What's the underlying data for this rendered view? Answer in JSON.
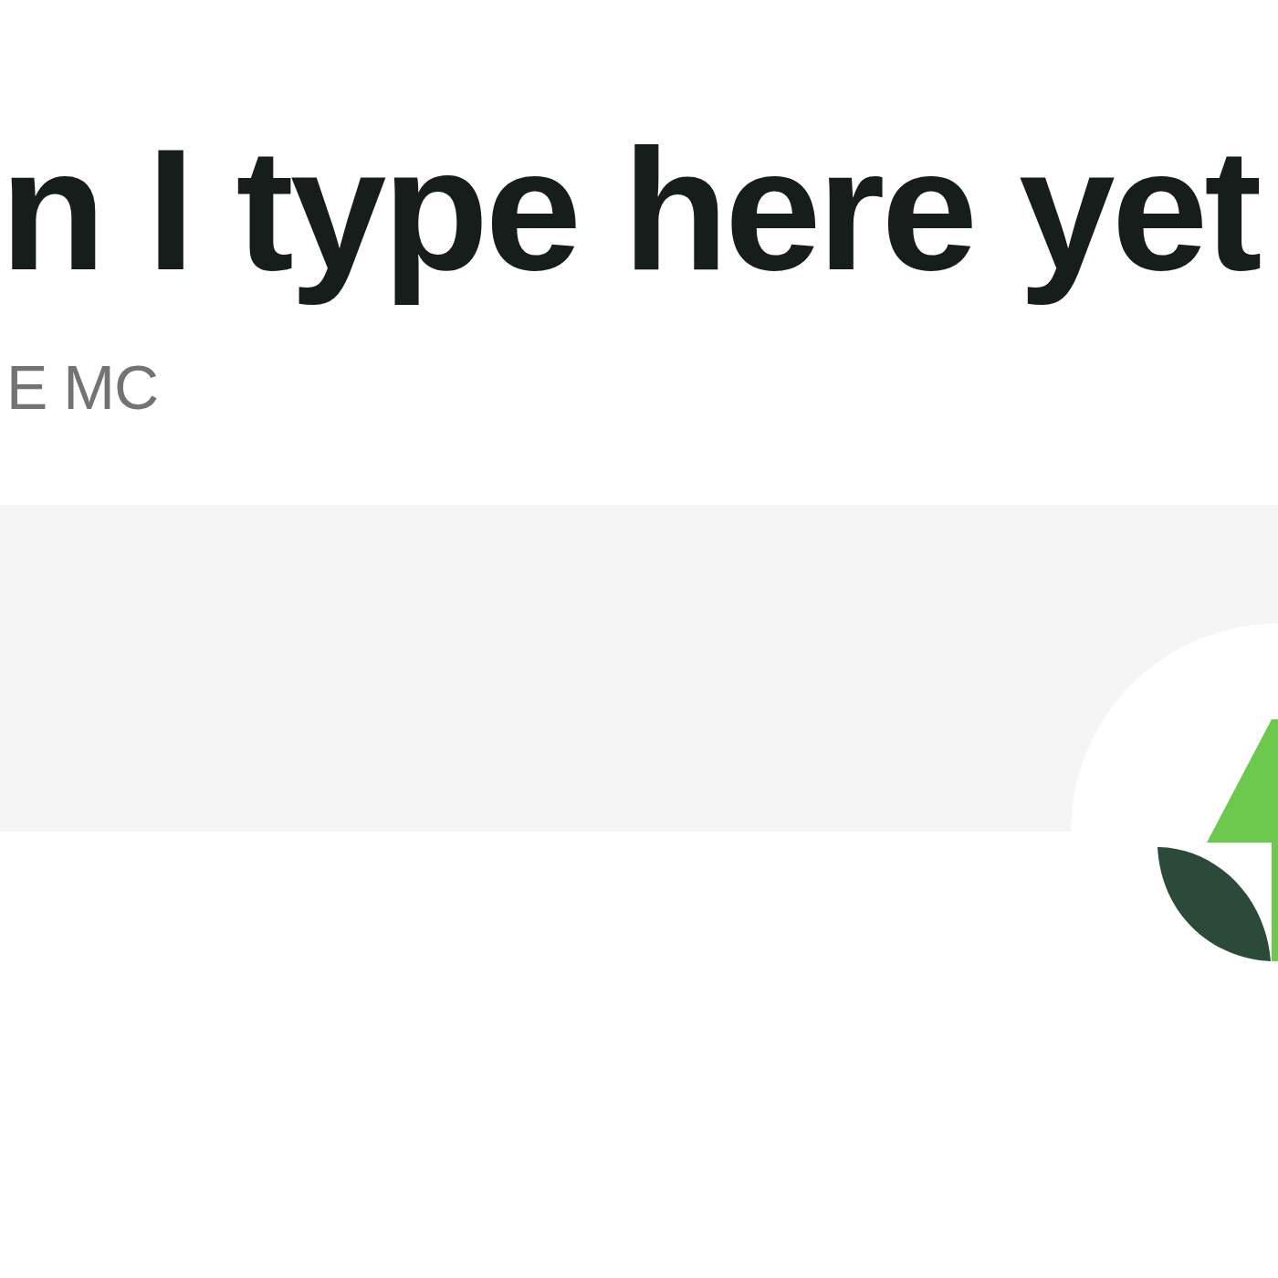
{
  "heading": "n I type here yet",
  "subtitle": "E MC"
}
